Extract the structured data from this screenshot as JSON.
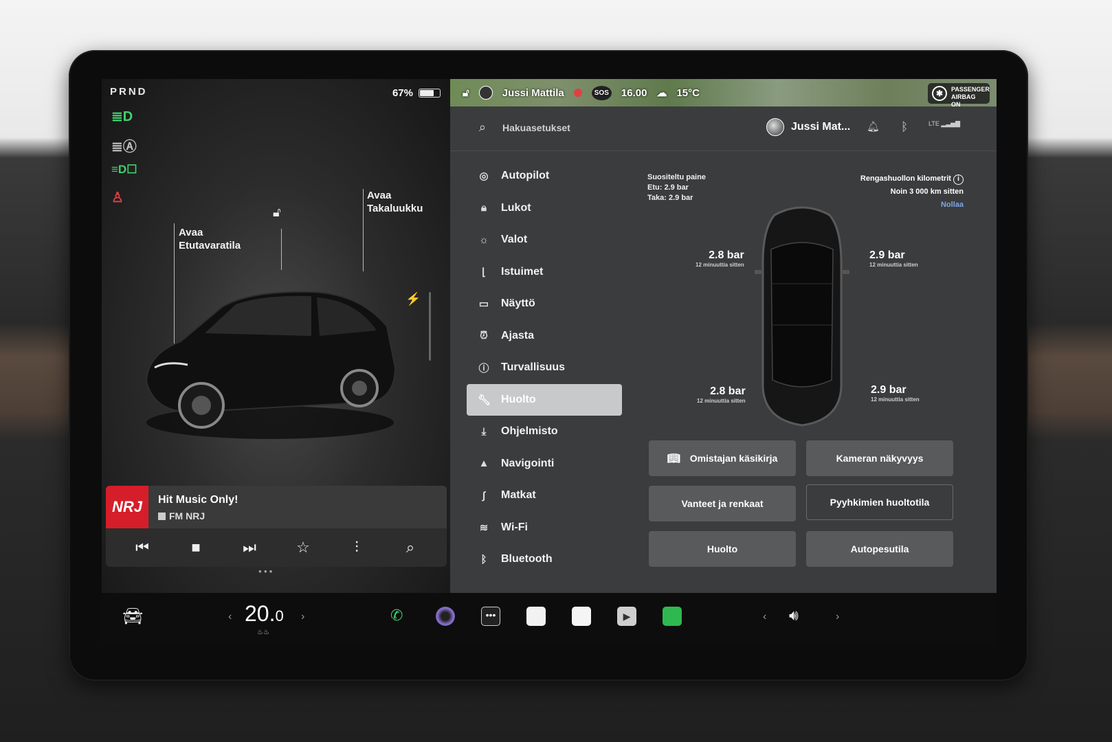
{
  "status": {
    "gear": "PRND",
    "battery_percent": "67%",
    "battery_level": 0.67
  },
  "car_view": {
    "frunk_label_line1": "Avaa",
    "frunk_label_line2": "Etutavaratila",
    "trunk_label_line1": "Avaa",
    "trunk_label_line2": "Takaluukku"
  },
  "media": {
    "station_logo": "NRJ",
    "title": "Hit Music Only!",
    "source": "FM NRJ"
  },
  "topbar": {
    "driver": "Jussi Mattila",
    "sos": "SOS",
    "time": "16.00",
    "temperature": "15°C",
    "airbag_line1": "PASSENGER",
    "airbag_line2": "AIRBAG ON"
  },
  "header": {
    "search_placeholder": "Hakuasetukset",
    "profile_name": "Jussi Mat...",
    "lte": "LTE"
  },
  "nav": {
    "items": [
      {
        "label": "Autopilot",
        "icon": "steering-wheel-icon"
      },
      {
        "label": "Lukot",
        "icon": "lock-icon"
      },
      {
        "label": "Valot",
        "icon": "sun-icon"
      },
      {
        "label": "Istuimet",
        "icon": "seat-icon"
      },
      {
        "label": "Näyttö",
        "icon": "display-icon"
      },
      {
        "label": "Ajasta",
        "icon": "alarm-clock-icon"
      },
      {
        "label": "Turvallisuus",
        "icon": "info-circle-icon"
      },
      {
        "label": "Huolto",
        "icon": "wrench-icon"
      },
      {
        "label": "Ohjelmisto",
        "icon": "download-icon"
      },
      {
        "label": "Navigointi",
        "icon": "navigation-arrow-icon"
      },
      {
        "label": "Matkat",
        "icon": "trips-icon"
      },
      {
        "label": "Wi-Fi",
        "icon": "wifi-icon"
      },
      {
        "label": "Bluetooth",
        "icon": "bluetooth-icon"
      }
    ],
    "active": "Huolto"
  },
  "service": {
    "recommended_title": "Suositeltu paine",
    "front": "Etu: 2.9 bar",
    "rear": "Taka: 2.9 bar",
    "rotation_title": "Rengashuollon kilometrit",
    "rotation_value": "Noin 3 000 km sitten",
    "reset": "Nollaa",
    "tires": {
      "front_left": {
        "value": "2.8 bar",
        "age": "12 minuuttia sitten"
      },
      "front_right": {
        "value": "2.9 bar",
        "age": "12 minuuttia sitten"
      },
      "rear_left": {
        "value": "2.8 bar",
        "age": "12 minuuttia sitten"
      },
      "rear_right": {
        "value": "2.9 bar",
        "age": "12 minuuttia sitten"
      }
    },
    "buttons": {
      "manual": "Omistajan käsikirja",
      "camera": "Kameran näkyvyys",
      "wheels": "Vanteet ja renkaat",
      "wiper": "Pyyhkimien huoltotila",
      "service": "Huolto",
      "carwash": "Autopesutila"
    }
  },
  "bottom": {
    "temp_whole": "20.",
    "temp_decimal": "0"
  },
  "colors": {
    "nrj_red": "#d61e2a",
    "light_green": "#3fd26a",
    "warning_red": "#e04040",
    "link_blue": "#7ea6e8"
  }
}
